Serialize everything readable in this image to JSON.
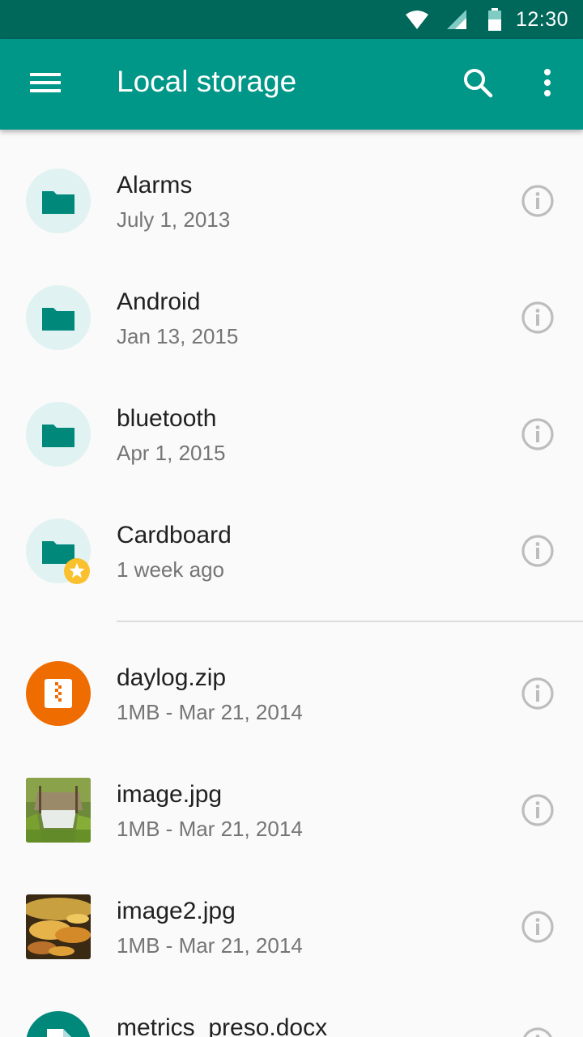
{
  "status_bar": {
    "time": "12:30",
    "icons": [
      "wifi-icon",
      "cell-signal-icon",
      "battery-icon"
    ]
  },
  "app_bar": {
    "title": "Local storage",
    "menu_icon": "hamburger-menu-icon",
    "search_icon": "search-icon",
    "overflow_icon": "more-vert-icon"
  },
  "colors": {
    "primary": "#009688",
    "primary_dark": "#00675b",
    "folder_bg": "#e0f2f1",
    "folder_icon": "#00897b",
    "zip": "#ef6c00",
    "star": "#fbc02d"
  },
  "folders": [
    {
      "name": "Alarms",
      "meta": "July 1, 2013",
      "starred": false
    },
    {
      "name": "Android",
      "meta": "Jan 13, 2015",
      "starred": false
    },
    {
      "name": "bluetooth",
      "meta": "Apr 1, 2015",
      "starred": false
    },
    {
      "name": "Cardboard",
      "meta": "1 week ago",
      "starred": true
    }
  ],
  "files": [
    {
      "name": "daylog.zip",
      "meta": "1MB - Mar 21, 2014",
      "kind": "zip"
    },
    {
      "name": "image.jpg",
      "meta": "1MB - Mar 21, 2014",
      "kind": "image"
    },
    {
      "name": "image2.jpg",
      "meta": "1MB - Mar 21, 2014",
      "kind": "image"
    },
    {
      "name": "metrics_preso.docx",
      "meta": "",
      "kind": "doc"
    }
  ]
}
